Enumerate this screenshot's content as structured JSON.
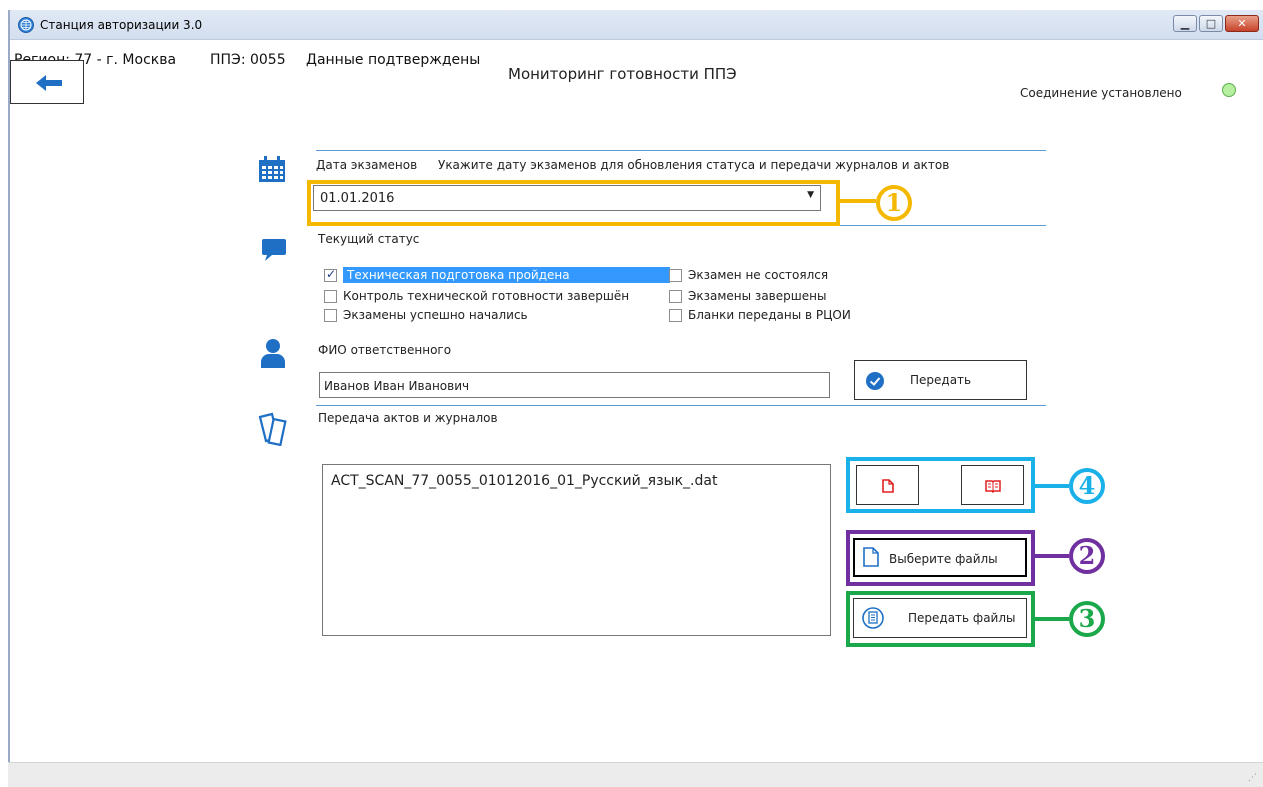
{
  "window": {
    "title": "Станция авторизации 3.0",
    "minimize_label": "▁",
    "maximize_label": "□",
    "close_label": "✕"
  },
  "info": {
    "region": "Регион: 77 - г. Москва",
    "ppe": "ППЭ: 0055",
    "status": "Данные подтверждены"
  },
  "header": {
    "title": "Мониторинг готовности ППЭ",
    "connection_text": "Соединение установлено",
    "connection_color": "#5bb04a"
  },
  "exam_date": {
    "label": "Дата экзаменов",
    "hint": "Укажите дату экзаменов для обновления статуса и передачи журналов и актов",
    "value": "01.01.2016",
    "icon": "calendar-icon"
  },
  "status": {
    "label": "Текущий статус",
    "icon": "chat-bubble-icon",
    "items": [
      {
        "label": "Техническая подготовка пройдена",
        "checked": true,
        "selected": true
      },
      {
        "label": "Контроль технической готовности завершён",
        "checked": false
      },
      {
        "label": "Экзамены успешно начались",
        "checked": false
      },
      {
        "label": "Экзамен не состоялся",
        "checked": false
      },
      {
        "label": "Экзамены завершены",
        "checked": false
      },
      {
        "label": "Бланки переданы в РЦОИ",
        "checked": false
      }
    ]
  },
  "responsible": {
    "label": "ФИО ответственного",
    "value": "Иванов Иван Иванович",
    "submit_label": "Передать",
    "icon": "person-icon"
  },
  "transfer": {
    "label": "Передача актов и журналов",
    "icon": "documents-icon",
    "files": [
      "ACT_SCAN_77_0055_01012016_01_Русский_язык_.dat"
    ],
    "choose_label": "Выберите файлы",
    "send_label": "Передать файлы"
  },
  "annotations": {
    "marker1": "1",
    "marker2": "2",
    "marker3": "3",
    "marker4": "4",
    "color1": "#f5b800",
    "color2": "#7030a0",
    "color3": "#1aa84a",
    "color4": "#1ab0e8"
  }
}
